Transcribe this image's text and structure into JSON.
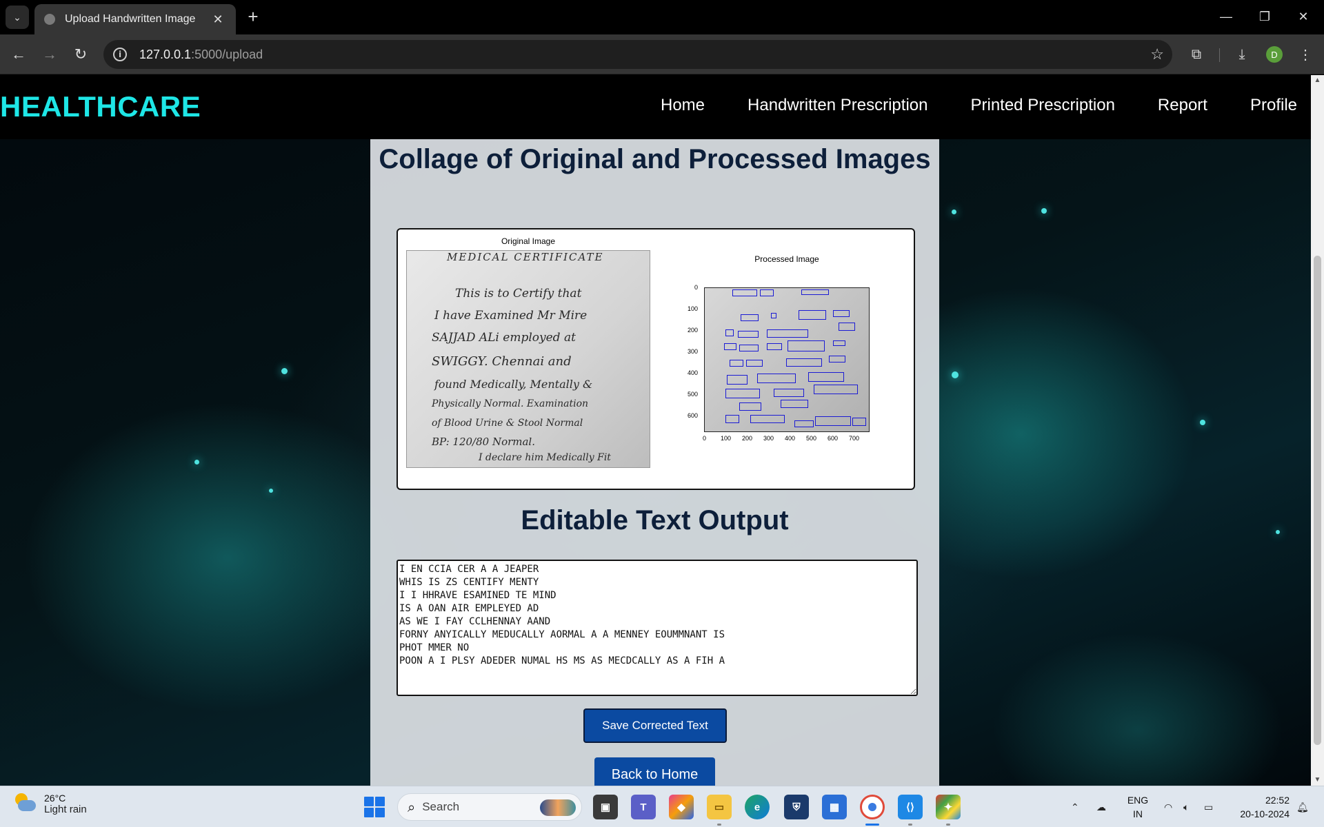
{
  "browser": {
    "tab_title": "Upload Handwritten Image",
    "tab_close": "✕",
    "new_tab": "+",
    "url_host": "127.0.0.1",
    "url_path": ":5000/upload",
    "profile_initial": "D"
  },
  "site": {
    "brand": "HEALTHCARE",
    "nav": [
      "Home",
      "Handwritten Prescription",
      "Printed Prescription",
      "Report",
      "Profile"
    ]
  },
  "main": {
    "collage_heading": "Collage of Original and Processed Images",
    "original_caption": "Original Image",
    "processed_caption": "Processed Image",
    "handwriting": {
      "title": "MEDICAL CERTIFICATE",
      "lines": [
        "This is to Certify that",
        "I have Examined Mr Mire",
        "SAJJAD ALi employed at",
        "SWIGGY. Chennai and",
        "found Medically, Mentally &",
        "Physically Normal. Examination",
        "of Blood Urine & Stool Normal",
        "BP: 120/80 Normal.",
        "I declare him Medically Fit"
      ]
    },
    "plot_axes": {
      "y_ticks": [
        "0",
        "100",
        "200",
        "300",
        "400",
        "500",
        "600"
      ],
      "x_ticks": [
        "0",
        "100",
        "200",
        "300",
        "400",
        "500",
        "600",
        "700"
      ]
    },
    "editable_heading": "Editable Text Output",
    "ocr_text": "I EN CCIA CER A A JEAPER\nWHIS IS ZS CENTIFY MENTY\nI I HHRAVE ESAMINED TE MIND\nIS A OAN AIR EMPLEYED AD\nAS WE I FAY CCLHENNAY AAND\nFORNY ANYICALLY MEDUCALLY AORMAL A A MENNEY EOUMMNANT IS\nPHOT MMER NO\nPOON A I PLSY ADEDER NUMAL HS MS AS MECDCALLY AS A FIH A",
    "save_button": "Save Corrected Text",
    "home_button": "Back to Home"
  },
  "taskbar": {
    "weather_temp": "26°C",
    "weather_desc": "Light rain",
    "search_placeholder": "Search",
    "lang_top": "ENG",
    "lang_bottom": "IN",
    "time": "22:52",
    "date": "20-10-2024"
  },
  "colors": {
    "brand": "#1ee6e6",
    "button": "#0b4aa1",
    "heading": "#0d1f3a",
    "box": "#1a1ad4"
  }
}
